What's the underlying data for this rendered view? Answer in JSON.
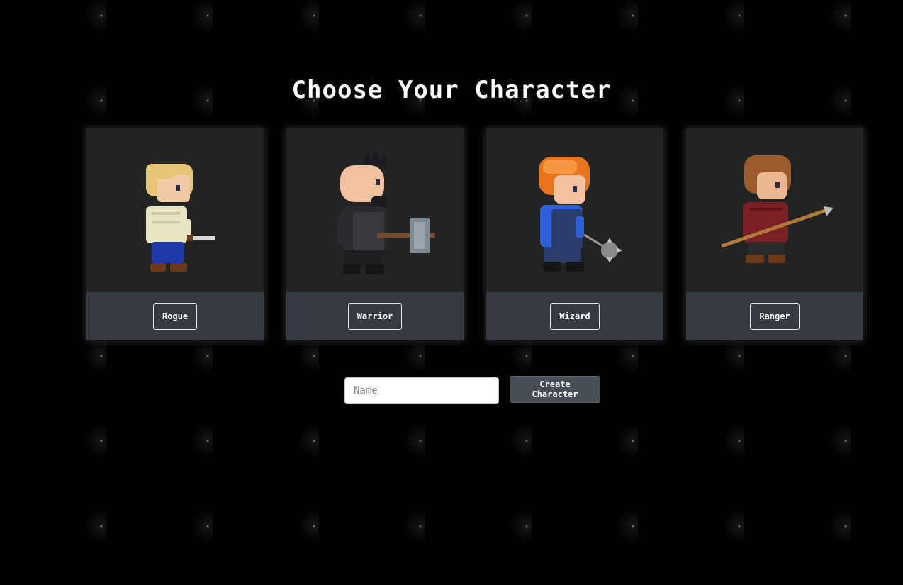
{
  "page": {
    "title": "Choose Your Character"
  },
  "characters": [
    {
      "label": "Rogue",
      "sprite": "rogue-sprite-dagger",
      "hair": "#e6c77a",
      "shirt": "#e9e4c4",
      "pants": "#1f3aa8"
    },
    {
      "label": "Warrior",
      "sprite": "warrior-sprite-hammer",
      "hair": "#1a1a22",
      "shirt": "#2a2a2e",
      "pants": "#3a3a3a"
    },
    {
      "label": "Wizard",
      "sprite": "wizard-sprite-flail",
      "hair": "#e8731e",
      "shirt": "#2f5fd6",
      "pants": "#2a3d6a"
    },
    {
      "label": "Ranger",
      "sprite": "ranger-sprite-spear",
      "hair": "#9a5a2e",
      "shirt": "#7a1f24",
      "pants": "#2a2a2a"
    }
  ],
  "form": {
    "name_placeholder": "Name",
    "name_value": "",
    "create_label": "Create Character"
  },
  "colors": {
    "background": "#000000",
    "card": "#222222",
    "card_footer": "#343a40",
    "create_button": "#454d55"
  }
}
